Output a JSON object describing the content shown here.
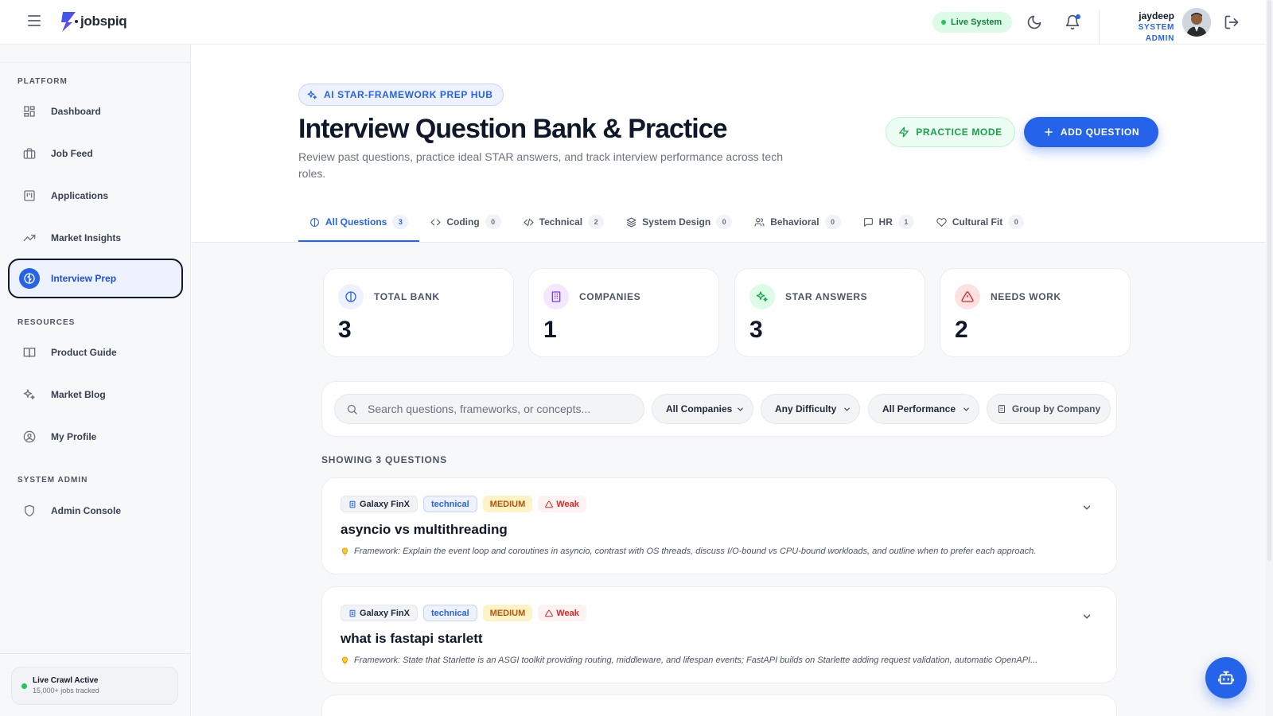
{
  "app": {
    "brand": "jobspiq"
  },
  "topbar": {
    "status_pill": "Live System",
    "user_name": "jaydeep",
    "user_role": "SYSTEM ADMIN"
  },
  "sidebar": {
    "sections": [
      {
        "label": "PLATFORM"
      },
      {
        "label": "RESOURCES"
      },
      {
        "label": "SYSTEM ADMIN"
      }
    ],
    "items": [
      {
        "label": "Dashboard",
        "icon": "grid-icon"
      },
      {
        "label": "Job Feed",
        "icon": "briefcase-icon"
      },
      {
        "label": "Applications",
        "icon": "kanban-icon"
      },
      {
        "label": "Market Insights",
        "icon": "trending-up-icon"
      },
      {
        "label": "Interview Prep",
        "icon": "brain-icon",
        "active": true
      },
      {
        "label": "Product Guide",
        "icon": "book-icon"
      },
      {
        "label": "Market Blog",
        "icon": "sparkles-icon"
      },
      {
        "label": "My Profile",
        "icon": "user-circle-icon"
      },
      {
        "label": "Admin Console",
        "icon": "shield-icon"
      }
    ],
    "crawl": {
      "title": "Live Crawl Active",
      "subtitle": "15,000+ jobs tracked"
    }
  },
  "header": {
    "badge": "AI STAR-FRAMEWORK PREP HUB",
    "title": "Interview Question Bank & Practice",
    "subtitle": "Review past questions, practice ideal STAR answers, and track interview performance across tech roles.",
    "practice_button": "PRACTICE MODE",
    "add_button": "ADD QUESTION"
  },
  "tabs": [
    {
      "label": "All Questions",
      "count": "3",
      "icon": "brain-icon",
      "active": true
    },
    {
      "label": "Coding",
      "count": "0",
      "icon": "code-icon"
    },
    {
      "label": "Technical",
      "count": "2",
      "icon": "code-icon"
    },
    {
      "label": "System Design",
      "count": "0",
      "icon": "layers-icon"
    },
    {
      "label": "Behavioral",
      "count": "0",
      "icon": "users-icon"
    },
    {
      "label": "HR",
      "count": "1",
      "icon": "message-icon"
    },
    {
      "label": "Cultural Fit",
      "count": "0",
      "icon": "heart-icon"
    }
  ],
  "stats": [
    {
      "label": "TOTAL BANK",
      "value": "3",
      "icon": "brain-icon",
      "color": "#2563eb"
    },
    {
      "label": "COMPANIES",
      "value": "1",
      "icon": "building-icon",
      "color": "#7c3aed"
    },
    {
      "label": "STAR ANSWERS",
      "value": "3",
      "icon": "sparkles-icon",
      "color": "#16a34a"
    },
    {
      "label": "NEEDS WORK",
      "value": "2",
      "icon": "alert-triangle-icon",
      "color": "#dc2626"
    }
  ],
  "filters": {
    "search_placeholder": "Search questions, frameworks, or concepts...",
    "company": "All Companies",
    "difficulty": "Any Difficulty",
    "performance": "All Performance",
    "group_button": "Group by Company"
  },
  "results": {
    "showing": "SHOWING 3 QUESTIONS"
  },
  "questions": [
    {
      "company": "Galaxy FinX",
      "type": "technical",
      "difficulty": "MEDIUM",
      "performance": "Weak",
      "title": "asyncio vs multithreading",
      "framework": "Framework: Explain the event loop and coroutines in asyncio, contrast with OS threads, discuss I/O-bound vs CPU-bound workloads, and outline when to prefer each approach."
    },
    {
      "company": "Galaxy FinX",
      "type": "technical",
      "difficulty": "MEDIUM",
      "performance": "Weak",
      "title": "what is fastapi starlett",
      "framework": "Framework: State that Starlette is an ASGI toolkit providing routing, middleware, and lifespan events; FastAPI builds on Starlette adding request validation, automatic OpenAPI..."
    }
  ],
  "colors": {
    "accent": "#2563eb",
    "success": "#16a34a",
    "danger": "#dc2626",
    "warning": "#b45309"
  }
}
